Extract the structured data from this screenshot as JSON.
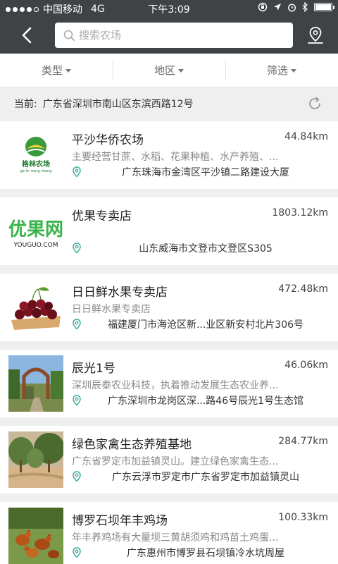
{
  "status_bar": {
    "carrier": "中国移动",
    "network": "4G",
    "time": "下午3:09"
  },
  "nav": {
    "search_placeholder": "搜索农场"
  },
  "filters": [
    {
      "label": "类型"
    },
    {
      "label": "地区"
    },
    {
      "label": "筛选"
    }
  ],
  "location": {
    "label": "当前:",
    "address": "广东省深圳市南山区东滨西路12号"
  },
  "farms": [
    {
      "name": "平沙华侨农场",
      "distance": "44.84km",
      "description": "主要经营甘蔗、水稻、花果种植、水产养殖、...",
      "address": "广东珠海市金湾区平沙镇二路建设大厦",
      "thumb": "farm-logo"
    },
    {
      "name": "优果专卖店",
      "distance": "1803.12km",
      "description": "",
      "address": "山东威海市文登市文登区S305",
      "thumb": "youguo-logo"
    },
    {
      "name": "日日鲜水果专卖店",
      "distance": "472.48km",
      "description": "日日鲜水果专卖店",
      "address": "福建厦门市海沧区新...业区新安村北片306号",
      "thumb": "cherries-photo"
    },
    {
      "name": "辰光1号",
      "distance": "46.06km",
      "description": "深圳辰泰农业科技，执着推动发展生态农业养...",
      "address": "广东深圳市龙岗区深...路46号辰光1号生态馆",
      "thumb": "gate-photo"
    },
    {
      "name": "绿色家禽生态养殖基地",
      "distance": "284.77km",
      "description": "广东省罗定市加益镇灵山。建立绿色家禽生态...",
      "address": "广东云浮市罗定市广东省罗定市加益镇灵山",
      "thumb": "orchard-photo"
    },
    {
      "name": "博罗石坝年丰鸡场",
      "distance": "100.33km",
      "description": "年丰养鸡场有大量坝三黄胡须鸡和鸡苗土鸡蛋...",
      "address": "广东惠州市博罗县石坝镇冷水坑周屋",
      "thumb": "chickens-photo"
    }
  ],
  "thumb_texts": {
    "farm_logo_cn": "格林农场",
    "farm_logo_en": "ge lin nong chang",
    "youguo_cn": "优果网",
    "youguo_en": "YOUGUO.COM"
  },
  "colors": {
    "nav_bg": "#404346",
    "accent_green": "#3cae9a",
    "page_bg": "#efefef"
  }
}
